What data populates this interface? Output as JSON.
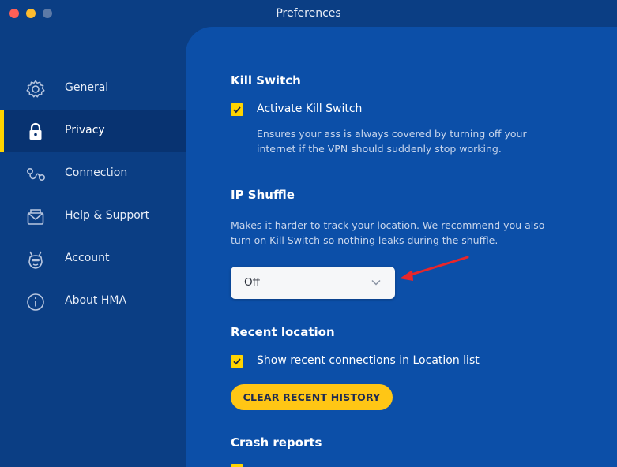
{
  "window": {
    "title": "Preferences"
  },
  "sidebar": {
    "items": [
      {
        "label": "General",
        "icon": "gear-icon"
      },
      {
        "label": "Privacy",
        "icon": "lock-icon",
        "active": true
      },
      {
        "label": "Connection",
        "icon": "connection-icon"
      },
      {
        "label": "Help & Support",
        "icon": "envelope-icon"
      },
      {
        "label": "Account",
        "icon": "donkey-avatar-icon"
      },
      {
        "label": "About HMA",
        "icon": "info-icon"
      }
    ]
  },
  "kill_switch": {
    "title": "Kill Switch",
    "checkbox_label": "Activate Kill Switch",
    "checked": true,
    "description": "Ensures your ass is always covered by turning off your\ninternet if the VPN should suddenly stop working."
  },
  "ip_shuffle": {
    "title": "IP Shuffle",
    "description": "Makes it harder to track your location. We recommend you also\nturn on Kill Switch so nothing leaks during the shuffle.",
    "select_value": "Off"
  },
  "recent_location": {
    "title": "Recent location",
    "checkbox_label": "Show recent connections in Location list",
    "checked": true,
    "clear_button": "CLEAR RECENT HISTORY"
  },
  "crash_reports": {
    "title": "Crash reports"
  },
  "colors": {
    "sidebar_bg": "#0b3e84",
    "panel_bg": "#0c4fa8",
    "accent_yellow": "#ffd400",
    "annotation_red": "#e8262a"
  }
}
